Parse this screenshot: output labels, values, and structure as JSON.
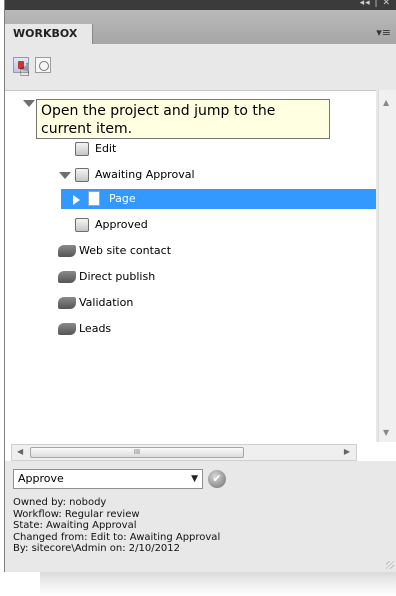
{
  "window": {
    "controls": "◂◂ | ✕"
  },
  "tab": {
    "label": "WORKBOX",
    "menu_icon": "panel-menu-icon"
  },
  "toolbar": {
    "open_button_icon": "open-item-icon",
    "refresh_button_icon": "refresh-icon"
  },
  "tooltip": {
    "text": "Open the project and jump to the current item."
  },
  "tree": {
    "items": [
      {
        "label": "Edit"
      },
      {
        "label": "Awaiting Approval"
      },
      {
        "label": "Page"
      },
      {
        "label": "Approved"
      },
      {
        "label": "Web site contact"
      },
      {
        "label": "Direct publish"
      },
      {
        "label": "Validation"
      },
      {
        "label": "Leads"
      }
    ],
    "selected_color": "#3399ff"
  },
  "hscroll": {
    "thumb_grip": "III"
  },
  "command": {
    "selected": "Approve",
    "arrow": "▼",
    "apply_icon": "check-icon",
    "apply_glyph": "✔"
  },
  "details": {
    "owned_by": "Owned by: nobody",
    "workflow": "Workflow: Regular review",
    "state": "State: Awaiting Approval",
    "changed": "Changed from: Edit to: Awaiting Approval",
    "by": "By: sitecore\\Admin on: 2/10/2012"
  }
}
